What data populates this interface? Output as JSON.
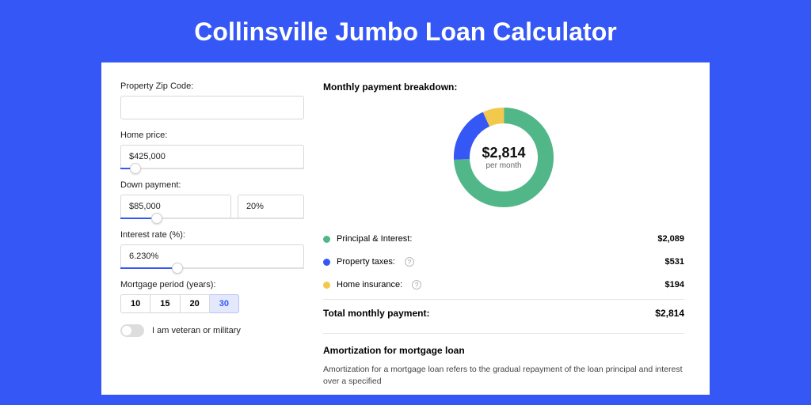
{
  "title": "Collinsville Jumbo Loan Calculator",
  "colors": {
    "primary": "#3557f5",
    "green": "#52b788",
    "yellow": "#f2c94c"
  },
  "form": {
    "zip": {
      "label": "Property Zip Code:",
      "value": ""
    },
    "price": {
      "label": "Home price:",
      "value": "$425,000",
      "slider_pct": 8
    },
    "down": {
      "label": "Down payment:",
      "amount": "$85,000",
      "percent": "20%",
      "slider_pct": 20
    },
    "rate": {
      "label": "Interest rate (%):",
      "value": "6.230%",
      "slider_pct": 31
    },
    "period": {
      "label": "Mortgage period (years):",
      "options": [
        "10",
        "15",
        "20",
        "30"
      ],
      "selected": "30"
    },
    "veteran": {
      "label": "I am veteran or military",
      "checked": false
    }
  },
  "breakdown": {
    "title": "Monthly payment breakdown:",
    "center_amount": "$2,814",
    "center_sub": "per month",
    "items": [
      {
        "label": "Principal & Interest:",
        "value": "$2,089",
        "dot": "green",
        "help": false
      },
      {
        "label": "Property taxes:",
        "value": "$531",
        "dot": "blue",
        "help": true
      },
      {
        "label": "Home insurance:",
        "value": "$194",
        "dot": "yellow",
        "help": true
      }
    ],
    "total_label": "Total monthly payment:",
    "total_value": "$2,814"
  },
  "chart_data": {
    "type": "pie",
    "title": "Monthly payment breakdown",
    "categories": [
      "Principal & Interest",
      "Property taxes",
      "Home insurance"
    ],
    "values": [
      2089,
      531,
      194
    ],
    "colors": [
      "#52b788",
      "#3557f5",
      "#f2c94c"
    ],
    "center_label": "$2,814 per month"
  },
  "amort": {
    "title": "Amortization for mortgage loan",
    "text": "Amortization for a mortgage loan refers to the gradual repayment of the loan principal and interest over a specified"
  }
}
